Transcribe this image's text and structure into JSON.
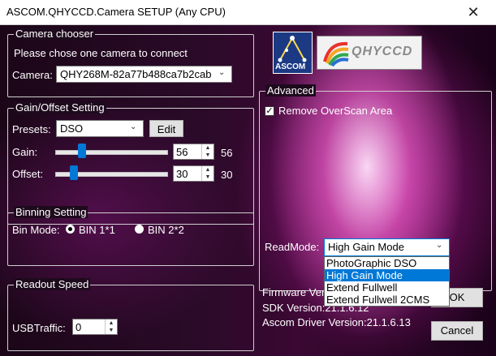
{
  "window": {
    "title": "ASCOM.QHYCCD.Camera SETUP (Any CPU)",
    "minimize_glyph": "—",
    "maximize_glyph": "☐",
    "close_glyph": "✕"
  },
  "camera_chooser": {
    "legend": "Camera chooser",
    "hint": "Please chose one camera to connect",
    "camera_label": "Camera:",
    "camera_value": "QHY268M-82a77b488ca7b2cab"
  },
  "gain_offset": {
    "legend": "Gain/Offset Setting",
    "presets_label": "Presets:",
    "presets_value": "DSO",
    "edit_label": "Edit",
    "gain_label": "Gain:",
    "gain_value": "56",
    "gain_max": "56",
    "gain_fraction": 0.22,
    "offset_label": "Offset:",
    "offset_value": "30",
    "offset_max": "30",
    "offset_fraction": 0.14
  },
  "binning": {
    "legend": "Binning Setting",
    "mode_label": "Bin Mode:",
    "bin1_label": "BIN 1*1",
    "bin2_label": "BIN 2*2"
  },
  "readout": {
    "legend": "Readout Speed",
    "usb_label": "USBTraffic:",
    "usb_value": "0"
  },
  "logos": {
    "ascom_text": "ASCOM",
    "qhy_text": "QHYCCD"
  },
  "advanced": {
    "legend": "Advanced",
    "overscan_label": "Remove OverScan Area",
    "readmode_label": "ReadMode:",
    "readmode_value": "High Gain Mode",
    "readmode_options": [
      "PhotoGraphic DSO",
      "High Gain Mode",
      "Extend Fullwell",
      "Extend Fullwell 2CMS"
    ]
  },
  "info": {
    "firmware": "Firmware Ver",
    "sdk": "SDK Version:21.1.6.12",
    "driver": "Ascom Driver Version:21.1.6.13"
  },
  "buttons": {
    "ok": "OK",
    "cancel": "Cancel"
  },
  "icons": {
    "combo_arrow": "⌄",
    "spin_up": "▲",
    "spin_down": "▼",
    "check": "✓"
  }
}
